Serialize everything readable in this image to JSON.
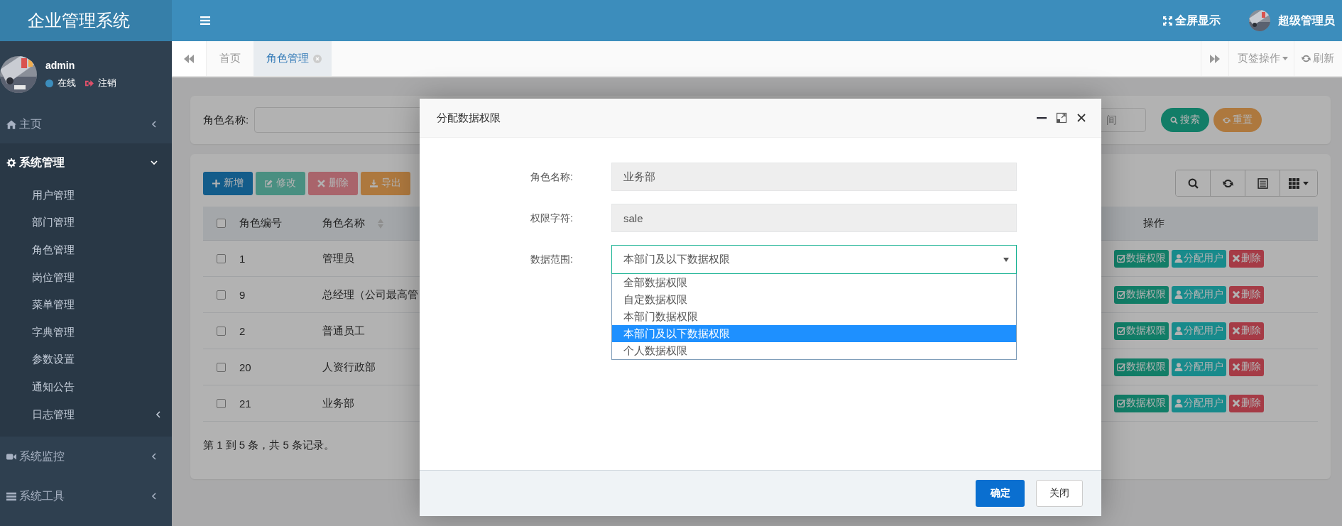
{
  "app": {
    "title": "企业管理系统"
  },
  "user_panel": {
    "name": "admin",
    "status": "在线",
    "logout": "注销"
  },
  "sidebar": {
    "items": [
      {
        "label": "主页",
        "expanded": false
      },
      {
        "label": "系统管理",
        "expanded": true,
        "children": [
          {
            "label": "用户管理"
          },
          {
            "label": "部门管理"
          },
          {
            "label": "角色管理"
          },
          {
            "label": "岗位管理"
          },
          {
            "label": "菜单管理"
          },
          {
            "label": "字典管理"
          },
          {
            "label": "参数设置"
          },
          {
            "label": "通知公告"
          },
          {
            "label": "日志管理",
            "expanded": false
          }
        ]
      },
      {
        "label": "系统监控",
        "expanded": false
      },
      {
        "label": "系统工具",
        "expanded": false
      }
    ]
  },
  "top_bar": {
    "fullscreen": "全屏显示",
    "user": "超级管理员"
  },
  "tabs": [
    {
      "label": "首页",
      "selected": false,
      "closable": false
    },
    {
      "label": "角色管理",
      "selected": true,
      "closable": true
    }
  ],
  "tab_actions": {
    "menu": "页签操作",
    "refresh": "刷新"
  },
  "search": {
    "label": "角色名称:",
    "time_field": "间",
    "buttons": [
      {
        "label": "搜索",
        "kind": "search"
      },
      {
        "label": "重置",
        "kind": "reset"
      }
    ]
  },
  "toolbar": [
    {
      "label": "新增",
      "kind": "add",
      "disabled": false
    },
    {
      "label": "修改",
      "kind": "edit",
      "disabled": true
    },
    {
      "label": "删除",
      "kind": "remove",
      "disabled": true
    },
    {
      "label": "导出",
      "kind": "export",
      "disabled": false
    }
  ],
  "table": {
    "all_checked": false,
    "columns": [
      {
        "label": "角色编号"
      },
      {
        "label": "角色名称"
      },
      {
        "label": "操作"
      }
    ],
    "rows": [
      {
        "checked": false,
        "id": "1",
        "name": "管理员",
        "actions": [
          {
            "label": "数据权限",
            "kind": "data"
          },
          {
            "label": "分配用户",
            "kind": "assign"
          },
          {
            "label": "删除",
            "kind": "remove"
          }
        ]
      },
      {
        "checked": false,
        "id": "9",
        "name": "总经理（公司最高管",
        "actions": [
          {
            "label": "数据权限",
            "kind": "data"
          },
          {
            "label": "分配用户",
            "kind": "assign"
          },
          {
            "label": "删除",
            "kind": "remove"
          }
        ]
      },
      {
        "checked": false,
        "id": "2",
        "name": "普通员工",
        "actions": [
          {
            "label": "数据权限",
            "kind": "data"
          },
          {
            "label": "分配用户",
            "kind": "assign"
          },
          {
            "label": "删除",
            "kind": "remove"
          }
        ]
      },
      {
        "checked": false,
        "id": "20",
        "name": "人资行政部",
        "actions": [
          {
            "label": "数据权限",
            "kind": "data"
          },
          {
            "label": "分配用户",
            "kind": "assign"
          },
          {
            "label": "删除",
            "kind": "remove"
          }
        ]
      },
      {
        "checked": false,
        "id": "21",
        "name": "业务部",
        "actions": [
          {
            "label": "数据权限",
            "kind": "data"
          },
          {
            "label": "分配用户",
            "kind": "assign"
          },
          {
            "label": "删除",
            "kind": "remove"
          }
        ]
      }
    ],
    "footer": "第 1 到 5 条，共 5 条记录。"
  },
  "dialog": {
    "title": "分配数据权限",
    "fields": [
      {
        "label": "角色名称:",
        "kind": "readonly",
        "value": "业务部"
      },
      {
        "label": "权限字符:",
        "kind": "readonly",
        "value": "sale"
      },
      {
        "label": "数据范围:",
        "kind": "select",
        "value": "本部门及以下数据权限",
        "options": [
          {
            "label": "全部数据权限",
            "selected": false
          },
          {
            "label": "自定数据权限",
            "selected": false
          },
          {
            "label": "本部门数据权限",
            "selected": false
          },
          {
            "label": "本部门及以下数据权限",
            "selected": true
          },
          {
            "label": "个人数据权限",
            "selected": false
          }
        ]
      }
    ],
    "buttons": [
      {
        "label": "确定",
        "kind": "primary"
      },
      {
        "label": "关闭",
        "kind": "default"
      }
    ]
  }
}
